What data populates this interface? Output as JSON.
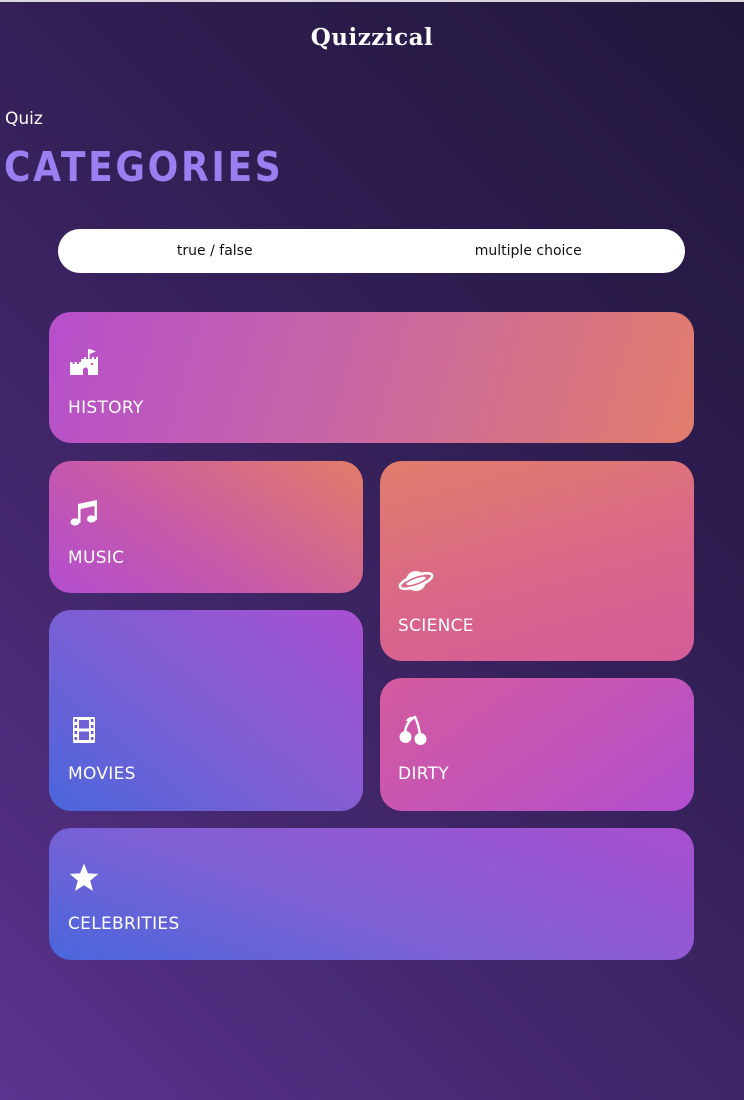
{
  "app": {
    "title": "Quizzical"
  },
  "header": {
    "subtitle": "Quiz",
    "heading": "CATEGORIES"
  },
  "mode_toggle": {
    "options": [
      {
        "label": "true / false"
      },
      {
        "label": "multiple choice"
      }
    ]
  },
  "categories": [
    {
      "label": "HISTORY",
      "icon": "castle-icon"
    },
    {
      "label": "MUSIC",
      "icon": "music-note-icon"
    },
    {
      "label": "SCIENCE",
      "icon": "planet-icon"
    },
    {
      "label": "MOVIES",
      "icon": "film-icon"
    },
    {
      "label": "DIRTY",
      "icon": "cherries-icon"
    },
    {
      "label": "CELEBRITIES",
      "icon": "star-icon"
    }
  ],
  "colors": {
    "background_dark": "#21163a",
    "background_light": "#5b3390",
    "heading_accent": "#9a7ff1",
    "card_orange": "#e17d6c",
    "card_pink": "#d45c99",
    "card_purple": "#a94fd0",
    "card_blue": "#4a66dc"
  }
}
